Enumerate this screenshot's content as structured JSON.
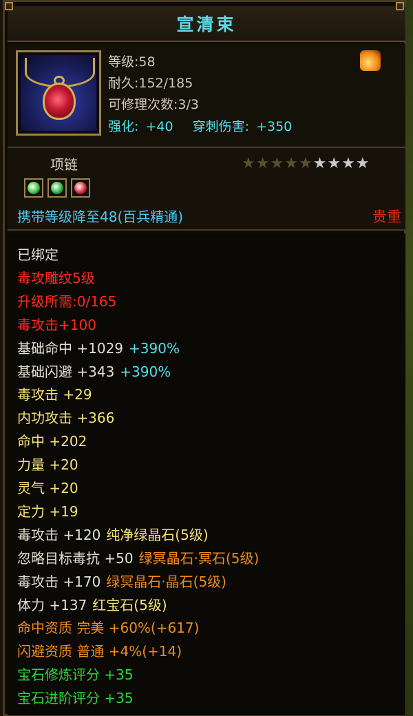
{
  "window": {
    "title": "宣清束"
  },
  "item": {
    "icon": "red-gem-necklace-icon",
    "level": "等级:58",
    "durability": "耐久:152/185",
    "repair_count": "可修理次数:3/3",
    "enhance_label": "强化:",
    "enhance_value": "+40",
    "pierce_label": "穿刺伤害:",
    "pierce_value": "+350",
    "side_icon": "fire-rune-icon"
  },
  "sub": {
    "type": "项链",
    "stars_total": 9,
    "stars_filled": 5,
    "gems": [
      {
        "icon": "green-gem-icon",
        "color": "#3ec83a"
      },
      {
        "icon": "green-gem-icon",
        "color": "#2fb64a"
      },
      {
        "icon": "red-gem-icon",
        "color": "#e02838"
      }
    ],
    "carry_level": "携带等级降至48(百兵精通)",
    "rarity": "贵重"
  },
  "attributes": [
    {
      "parts": [
        {
          "t": "已绑定",
          "c": "white"
        }
      ]
    },
    {
      "parts": [
        {
          "t": "毒攻雕纹5级",
          "c": "red"
        }
      ]
    },
    {
      "parts": [
        {
          "t": "升级所需:0/165",
          "c": "red"
        }
      ]
    },
    {
      "parts": [
        {
          "t": "毒攻击+100",
          "c": "red"
        }
      ]
    },
    {
      "parts": [
        {
          "t": "基础命中 +1029",
          "c": "white"
        },
        {
          "t": "+390%",
          "c": "cyan"
        }
      ]
    },
    {
      "parts": [
        {
          "t": "基础闪避 +343",
          "c": "white"
        },
        {
          "t": "+390%",
          "c": "cyan"
        }
      ]
    },
    {
      "parts": [
        {
          "t": "毒攻击 +29",
          "c": "yellow"
        }
      ]
    },
    {
      "parts": [
        {
          "t": "内功攻击 +366",
          "c": "yellow"
        }
      ]
    },
    {
      "parts": [
        {
          "t": "命中 +202",
          "c": "yellow"
        }
      ]
    },
    {
      "parts": [
        {
          "t": "力量 +20",
          "c": "yellow"
        }
      ]
    },
    {
      "parts": [
        {
          "t": "灵气 +20",
          "c": "yellow"
        }
      ]
    },
    {
      "parts": [
        {
          "t": "定力 +19",
          "c": "yellow"
        }
      ]
    },
    {
      "parts": [
        {
          "t": "毒攻击 +120",
          "c": "white"
        },
        {
          "t": "纯净绿晶石(5级)",
          "c": "yellow"
        }
      ]
    },
    {
      "parts": [
        {
          "t": "忽略目标毒抗 +50",
          "c": "white"
        },
        {
          "t": "绿冥晶石·冥石(5级)",
          "c": "orange"
        }
      ]
    },
    {
      "parts": [
        {
          "t": "毒攻击 +170",
          "c": "white"
        },
        {
          "t": "绿冥晶石·晶石(5级)",
          "c": "orange"
        }
      ]
    },
    {
      "parts": [
        {
          "t": "体力 +137",
          "c": "white"
        },
        {
          "t": "红宝石(5级)",
          "c": "yellow"
        }
      ]
    },
    {
      "parts": [
        {
          "t": "命中资质  完美 +60%(+617)",
          "c": "orange"
        }
      ]
    },
    {
      "parts": [
        {
          "t": "闪避资质  普通 +4%(+14)",
          "c": "orange"
        }
      ]
    },
    {
      "parts": [
        {
          "t": "宝石修炼评分 +35",
          "c": "green"
        }
      ]
    },
    {
      "parts": [
        {
          "t": "宝石进阶评分 +35",
          "c": "green"
        }
      ]
    }
  ]
}
